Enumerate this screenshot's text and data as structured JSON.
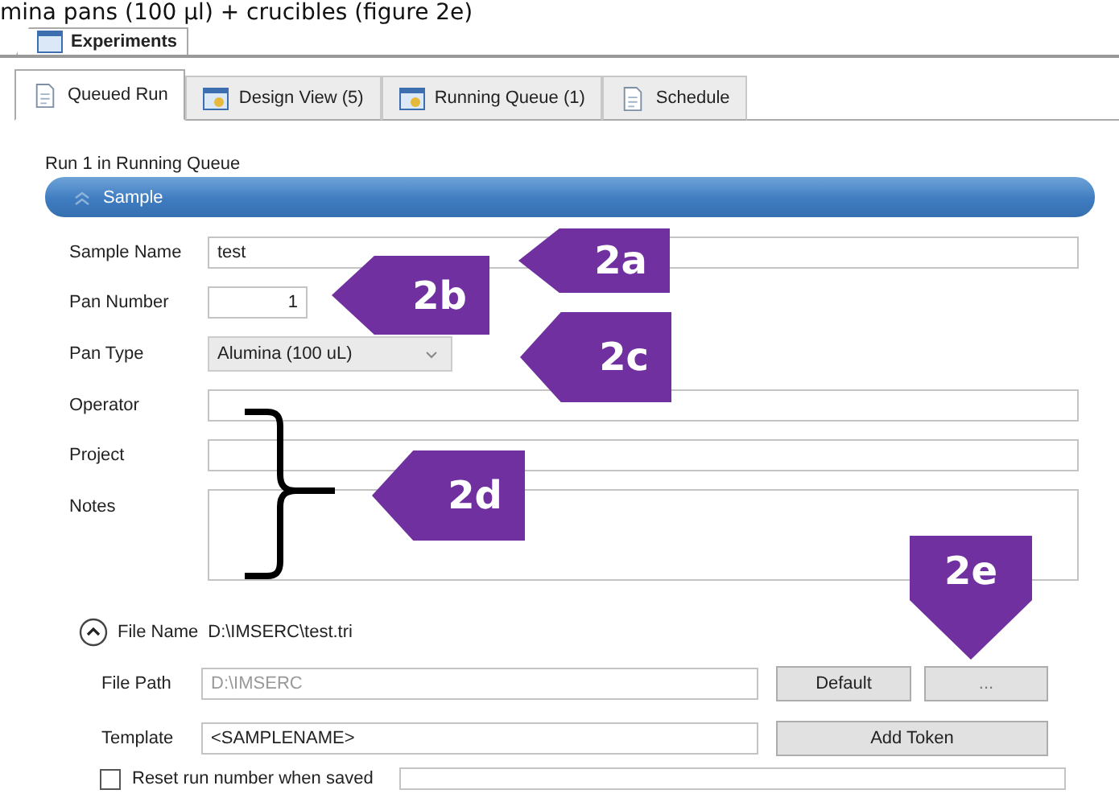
{
  "caption": "mina pans (100 µl) + crucibles (figure 2e)",
  "window_tab": {
    "label": "Experiments"
  },
  "tabs": [
    {
      "label": "Queued Run",
      "selected": true,
      "kind": "document"
    },
    {
      "label": "Design View (5)",
      "selected": false,
      "kind": "window"
    },
    {
      "label": "Running Queue (1)",
      "selected": false,
      "kind": "window"
    },
    {
      "label": "Schedule",
      "selected": false,
      "kind": "document"
    }
  ],
  "run_title": "Run 1 in Running Queue",
  "section": {
    "title": "Sample",
    "expanded": true
  },
  "fields": [
    {
      "label": "Sample Name",
      "kind": "text",
      "value": "test"
    },
    {
      "label": "Pan Number",
      "kind": "number",
      "value": "1"
    },
    {
      "label": "Pan Type",
      "kind": "select",
      "value": "Alumina (100 uL)"
    },
    {
      "label": "Operator",
      "kind": "text"
    },
    {
      "label": "Project",
      "kind": "text"
    },
    {
      "label": "Notes",
      "kind": "textarea"
    }
  ],
  "file_name": {
    "label": "File Name",
    "value": "D:\\IMSERC\\test.tri",
    "expanded": true
  },
  "file_path": {
    "label": "File Path",
    "value": "D:\\IMSERC",
    "disabled": true,
    "buttons": [
      "Default",
      "..."
    ]
  },
  "template": {
    "label": "Template",
    "value": "<SAMPLENAME>",
    "button": "Add Token"
  },
  "reset": {
    "label": "Reset run number when saved",
    "checked": false
  },
  "annotations": [
    {
      "label": "2a",
      "kind": "left"
    },
    {
      "label": "2b",
      "kind": "left"
    },
    {
      "label": "2c",
      "kind": "left"
    },
    {
      "label": "2d",
      "kind": "left"
    },
    {
      "label": "2e",
      "kind": "down"
    }
  ]
}
